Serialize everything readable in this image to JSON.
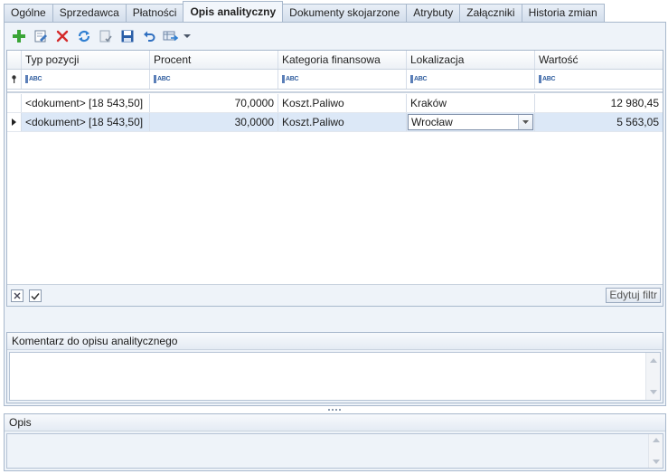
{
  "tabs": [
    "Ogólne",
    "Sprzedawca",
    "Płatności",
    "Opis analityczny",
    "Dokumenty skojarzone",
    "Atrybuty",
    "Załączniki",
    "Historia zmian"
  ],
  "active_tab": "Opis analityczny",
  "toolbar": {
    "icons": [
      "add-icon",
      "edit-icon",
      "delete-icon",
      "refresh-icon",
      "checklist-icon",
      "save-icon",
      "undo-icon",
      "export-icon",
      "dropdown-arrow-icon"
    ]
  },
  "grid": {
    "columns": [
      "Typ pozycji",
      "Procent",
      "Kategoria finansowa",
      "Lokalizacja",
      "Wartość"
    ],
    "filter_placeholder": "ABC",
    "rows": [
      {
        "typ": "<dokument> [18 543,50]",
        "procent": "70,0000",
        "kategoria": "Koszt.Paliwo",
        "lokalizacja": "Kraków",
        "wartosc": "12 980,45",
        "selected": false
      },
      {
        "typ": "<dokument> [18 543,50]",
        "procent": "30,0000",
        "kategoria": "Koszt.Paliwo",
        "lokalizacja": "Wrocław",
        "wartosc": "5 563,05",
        "selected": true
      }
    ],
    "filter_checkbox_checked": true,
    "edit_filter_label": "Edytuj filtr"
  },
  "comment_section": {
    "title": "Komentarz do opisu analitycznego",
    "value": ""
  },
  "opis_section": {
    "title": "Opis",
    "value": ""
  },
  "colors": {
    "accent": "#a8b8cc",
    "selected_row": "#dce8f7",
    "panel_bg": "#eef3f9"
  }
}
